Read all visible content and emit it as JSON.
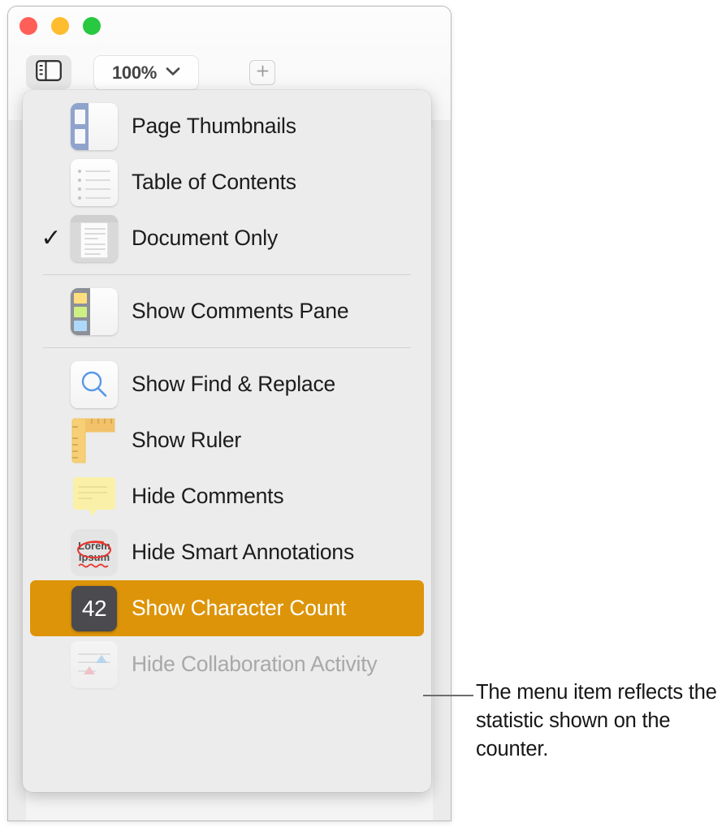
{
  "window": {
    "traffic_lights": [
      "close",
      "minimize",
      "maximize"
    ],
    "colors": {
      "close": "#ff5f57",
      "minimize": "#febc2e",
      "maximize": "#28c840",
      "menu_background": "#ececec",
      "highlight": "#dd9408",
      "badge": "#4a4a4f"
    }
  },
  "toolbar": {
    "sidebar_toggle_icon": "sidebar-icon",
    "zoom_value": "100%",
    "zoom_chevron_icon": "chevron-down-icon",
    "insert_icon": "plus-in-square-icon"
  },
  "menu": {
    "items": [
      {
        "label": "Page Thumbnails",
        "icon": "page-thumbnails-icon",
        "checked": false,
        "selected": false,
        "disabled": false
      },
      {
        "label": "Table of Contents",
        "icon": "table-of-contents-icon",
        "checked": false,
        "selected": false,
        "disabled": false
      },
      {
        "label": "Document Only",
        "icon": "document-only-icon",
        "checked": true,
        "selected": false,
        "disabled": false
      },
      {
        "label": "Show Comments Pane",
        "icon": "comments-pane-icon",
        "checked": false,
        "selected": false,
        "disabled": false
      },
      {
        "label": "Show Find & Replace",
        "icon": "search-icon",
        "checked": false,
        "selected": false,
        "disabled": false
      },
      {
        "label": "Show Ruler",
        "icon": "ruler-icon",
        "checked": false,
        "selected": false,
        "disabled": false
      },
      {
        "label": "Hide Comments",
        "icon": "sticky-note-icon",
        "checked": false,
        "selected": false,
        "disabled": false
      },
      {
        "label": "Hide Smart Annotations",
        "icon": "smart-annotations-icon",
        "checked": false,
        "selected": false,
        "disabled": false
      },
      {
        "label": "Show Character Count",
        "icon": "character-count-icon",
        "checked": false,
        "selected": true,
        "disabled": false
      },
      {
        "label": "Hide Collaboration Activity",
        "icon": "collaboration-activity-icon",
        "checked": false,
        "selected": false,
        "disabled": true
      }
    ],
    "checkmark_glyph": "✓",
    "character_count_value": "42",
    "smart_annotation_text": {
      "line1": "Lorem",
      "line2": "Ipsum"
    }
  },
  "callout": {
    "text": "The menu item reflects the statistic shown on the counter."
  }
}
